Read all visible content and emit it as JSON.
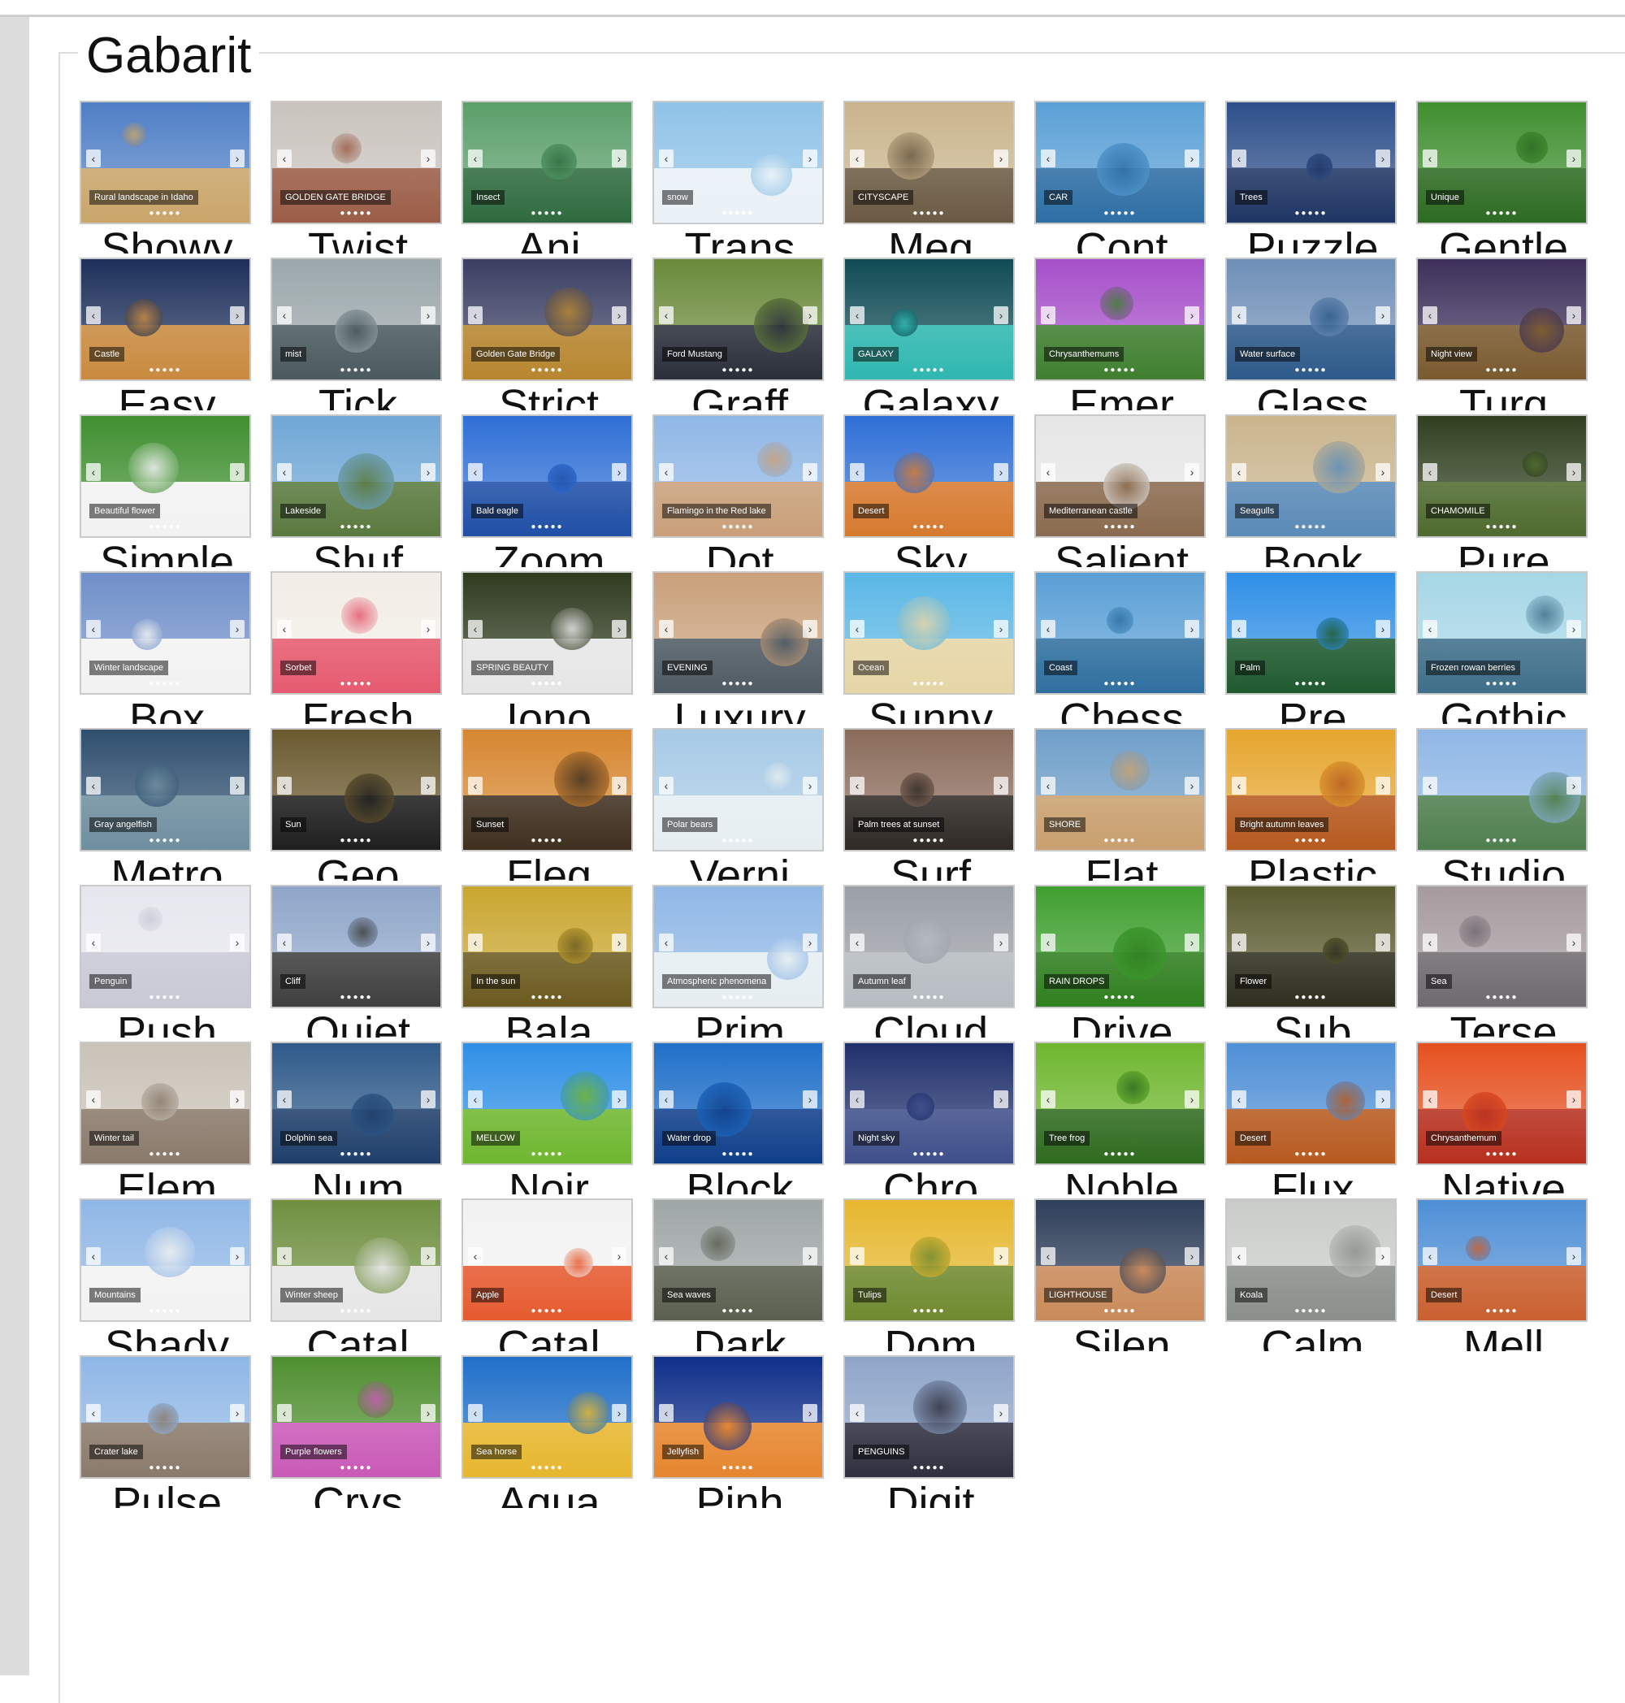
{
  "groupbox": {
    "title": "Gabarit"
  },
  "templates": [
    {
      "label": "Showy",
      "caption": "Rural landscape in Idaho",
      "colors": [
        "#4f7fc6",
        "#c9a56a"
      ]
    },
    {
      "label": "Twist",
      "caption": "GOLDEN GATE BRIDGE",
      "colors": [
        "#c9c3bd",
        "#9b5d47"
      ]
    },
    {
      "label": "Ani",
      "caption": "Insect",
      "colors": [
        "#5a9f6a",
        "#2f6b3f"
      ]
    },
    {
      "label": "Trans",
      "caption": "snow",
      "colors": [
        "#8fc3e8",
        "#e9f1f7"
      ]
    },
    {
      "label": "Meg",
      "caption": "CITYSCAPE",
      "colors": [
        "#c9b48c",
        "#6b5a43"
      ]
    },
    {
      "label": "Cont",
      "caption": "CAR",
      "colors": [
        "#5aa0d6",
        "#2d6ea4"
      ]
    },
    {
      "label": "Puzzle",
      "caption": "Trees",
      "colors": [
        "#2d4f8a",
        "#1f3563"
      ]
    },
    {
      "label": "Gentle",
      "caption": "Unique",
      "colors": [
        "#3f8f2f",
        "#2d6b22"
      ]
    },
    {
      "label": "Easy",
      "caption": "Castle",
      "colors": [
        "#1d2f5a",
        "#c98a3f"
      ]
    },
    {
      "label": "Tick",
      "caption": "mist",
      "colors": [
        "#9ba7ab",
        "#4b5a5f"
      ]
    },
    {
      "label": "Strict",
      "caption": "Golden Gate Bridge",
      "colors": [
        "#3a3f63",
        "#b7862f"
      ]
    },
    {
      "label": "Graff",
      "caption": "Ford Mustang",
      "colors": [
        "#6a8a3a",
        "#2b2f3a"
      ]
    },
    {
      "label": "Galaxy",
      "caption": "GALAXY",
      "colors": [
        "#0f4b54",
        "#2fb7b0"
      ]
    },
    {
      "label": "Emer",
      "caption": "Chrysanthemums",
      "colors": [
        "#a64fc9",
        "#3f7f2f"
      ]
    },
    {
      "label": "Glass",
      "caption": "Water surface",
      "colors": [
        "#6f8fb7",
        "#2d5a8a"
      ]
    },
    {
      "label": "Turq",
      "caption": "Night view",
      "colors": [
        "#3d2f5a",
        "#7a5a2f"
      ]
    },
    {
      "label": "Simple",
      "caption": "Beautiful flower",
      "colors": [
        "#3f8f2f",
        "#f2f2f2"
      ]
    },
    {
      "label": "Shuf",
      "caption": "Lakeside",
      "colors": [
        "#6fa7d6",
        "#5a7a3f"
      ]
    },
    {
      "label": "Zoom",
      "caption": "Bald eagle",
      "colors": [
        "#2f6fd6",
        "#1f4fa6"
      ]
    },
    {
      "label": "Dot",
      "caption": "Flamingo in the Red lake",
      "colors": [
        "#8fb7e6",
        "#c9a07a"
      ]
    },
    {
      "label": "Sky",
      "caption": "Desert",
      "colors": [
        "#2f6fd6",
        "#d67a2f"
      ]
    },
    {
      "label": "Salient",
      "caption": "Mediterranean castle",
      "colors": [
        "#e6e6e6",
        "#8a6b4f"
      ]
    },
    {
      "label": "Book",
      "caption": "Seagulls",
      "colors": [
        "#c9b48c",
        "#5a8ab7"
      ]
    },
    {
      "label": "Pure",
      "caption": "CHAMOMILE",
      "colors": [
        "#2f3f1f",
        "#4f6b2f"
      ]
    },
    {
      "label": "Box",
      "caption": "Winter landscape",
      "colors": [
        "#6f8fc9",
        "#f2f2f2"
      ]
    },
    {
      "label": "Fresh",
      "caption": "Sorbet",
      "colors": [
        "#f2ede6",
        "#e65a6f"
      ]
    },
    {
      "label": "Iono",
      "caption": "SPRING BEAUTY",
      "colors": [
        "#2f3a1f",
        "#e6e6e6"
      ]
    },
    {
      "label": "Luxury",
      "caption": "EVENING",
      "colors": [
        "#c9a07a",
        "#4f5a63"
      ]
    },
    {
      "label": "Sunny",
      "caption": "Ocean",
      "colors": [
        "#5ab7e6",
        "#e6d6a6"
      ]
    },
    {
      "label": "Chess",
      "caption": "Coast",
      "colors": [
        "#5a9fd6",
        "#2f6f9f"
      ]
    },
    {
      "label": "Pre",
      "caption": "Palm",
      "colors": [
        "#2f8fe6",
        "#1f5a2f"
      ]
    },
    {
      "label": "Gothic",
      "caption": "Frozen rowan berries",
      "colors": [
        "#a6d6e6",
        "#3f6f8a"
      ]
    },
    {
      "label": "Metro",
      "caption": "Gray angelfish",
      "colors": [
        "#2f4f6f",
        "#6f8f9f"
      ]
    },
    {
      "label": "Geo",
      "caption": "Sun",
      "colors": [
        "#6b5a2f",
        "#1f1f1f"
      ]
    },
    {
      "label": "Fleg",
      "caption": "Sunset",
      "colors": [
        "#d6862f",
        "#3f2f1f"
      ]
    },
    {
      "label": "Verni",
      "caption": "Polar bears",
      "colors": [
        "#a6c9e6",
        "#e6eef2"
      ]
    },
    {
      "label": "Surf",
      "caption": "Palm trees at sunset",
      "colors": [
        "#8a6b5a",
        "#2f2a26"
      ]
    },
    {
      "label": "Flat",
      "caption": "SHORE",
      "colors": [
        "#6f9fc9",
        "#c9a06f"
      ]
    },
    {
      "label": "Plastic",
      "caption": "Bright autumn leaves",
      "colors": [
        "#e6a62f",
        "#b75a1f"
      ]
    },
    {
      "label": "Studio",
      "caption": "",
      "colors": [
        "#8fb7e6",
        "#4f7f4f"
      ]
    },
    {
      "label": "Push",
      "caption": "Penguin",
      "colors": [
        "#e6e6ee",
        "#c9c9d6"
      ]
    },
    {
      "label": "Quiet",
      "caption": "Cliff",
      "colors": [
        "#8fa6c9",
        "#3f3f3f"
      ]
    },
    {
      "label": "Bala",
      "caption": "In the sun",
      "colors": [
        "#c9a62f",
        "#6b5a1f"
      ]
    },
    {
      "label": "Prim",
      "caption": "Atmospheric phenomena",
      "colors": [
        "#8fb7e6",
        "#e6eef2"
      ]
    },
    {
      "label": "Cloud",
      "caption": "Autumn leaf",
      "colors": [
        "#9a9fa6",
        "#b7bcc2"
      ]
    },
    {
      "label": "Drive",
      "caption": "RAIN DROPS",
      "colors": [
        "#3f9f2f",
        "#2f7f1f"
      ]
    },
    {
      "label": "Sub",
      "caption": "Flower",
      "colors": [
        "#5a5a2f",
        "#2f2f1f"
      ]
    },
    {
      "label": "Terse",
      "caption": "Sea",
      "colors": [
        "#a69a9f",
        "#6f6a6f"
      ]
    },
    {
      "label": "Elem",
      "caption": "Winter tail",
      "colors": [
        "#c9c2b7",
        "#8a7a6b"
      ]
    },
    {
      "label": "Num",
      "caption": "Dolphin sea",
      "colors": [
        "#2f5a8a",
        "#1f3f6b"
      ]
    },
    {
      "label": "Noir",
      "caption": "MELLOW",
      "colors": [
        "#2f8fe6",
        "#6fb72f"
      ]
    },
    {
      "label": "Block",
      "caption": "Water drop",
      "colors": [
        "#1f6fc9",
        "#0f3f8a"
      ]
    },
    {
      "label": "Chro",
      "caption": "Night sky",
      "colors": [
        "#1f2f6b",
        "#3f4f8a"
      ]
    },
    {
      "label": "Noble",
      "caption": "Tree frog",
      "colors": [
        "#6fb72f",
        "#2f6b1f"
      ]
    },
    {
      "label": "Flux",
      "caption": "Desert",
      "colors": [
        "#4f8fd6",
        "#b75a1f"
      ]
    },
    {
      "label": "Native",
      "caption": "Chrysanthemum",
      "colors": [
        "#e6501f",
        "#b7301f"
      ]
    },
    {
      "label": "Shady",
      "caption": "Mountains",
      "colors": [
        "#8fb7e6",
        "#f2f2f2"
      ]
    },
    {
      "label": "Catal",
      "caption": "Winter sheep",
      "colors": [
        "#6f8f3f",
        "#e6e6e6"
      ]
    },
    {
      "label": "Catal",
      "caption": "Apple",
      "colors": [
        "#f2f2f2",
        "#e65a2f"
      ]
    },
    {
      "label": "Dark",
      "caption": "Sea waves",
      "colors": [
        "#9fa6a6",
        "#5a5f4f"
      ]
    },
    {
      "label": "Dom",
      "caption": "Tulips",
      "colors": [
        "#e6b72f",
        "#6f8a2f"
      ]
    },
    {
      "label": "Silen",
      "caption": "LIGHTHOUSE",
      "colors": [
        "#2f3f5a",
        "#c98a5a"
      ]
    },
    {
      "label": "Calm",
      "caption": "Koala",
      "colors": [
        "#c9ccc9",
        "#8a8f8a"
      ]
    },
    {
      "label": "Mell",
      "caption": "Desert",
      "colors": [
        "#4f8fd6",
        "#c9602f"
      ]
    },
    {
      "label": "Pulse",
      "caption": "Crater lake",
      "colors": [
        "#8fb7e6",
        "#8a7a6b"
      ]
    },
    {
      "label": "Crys",
      "caption": "Purple flowers",
      "colors": [
        "#4f8f2f",
        "#c95ab7"
      ]
    },
    {
      "label": "Aqua",
      "caption": "Sea horse",
      "colors": [
        "#1f6fc9",
        "#e6b72f"
      ]
    },
    {
      "label": "Pinh",
      "caption": "Jellyfish",
      "colors": [
        "#0f2f8a",
        "#e6862f"
      ]
    },
    {
      "label": "Digit",
      "caption": "PENGUINS",
      "colors": [
        "#8fa6c9",
        "#2f2f3f"
      ]
    }
  ]
}
